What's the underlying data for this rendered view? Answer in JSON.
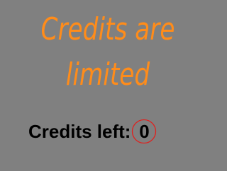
{
  "message": {
    "line1": "Credits are",
    "line2": "limited"
  },
  "credits": {
    "label": "Credits left:",
    "count": "0"
  },
  "colors": {
    "background": "#808080",
    "headline": "#FF8C1A",
    "label": "#000000",
    "highlight_ring": "#E0201E"
  }
}
